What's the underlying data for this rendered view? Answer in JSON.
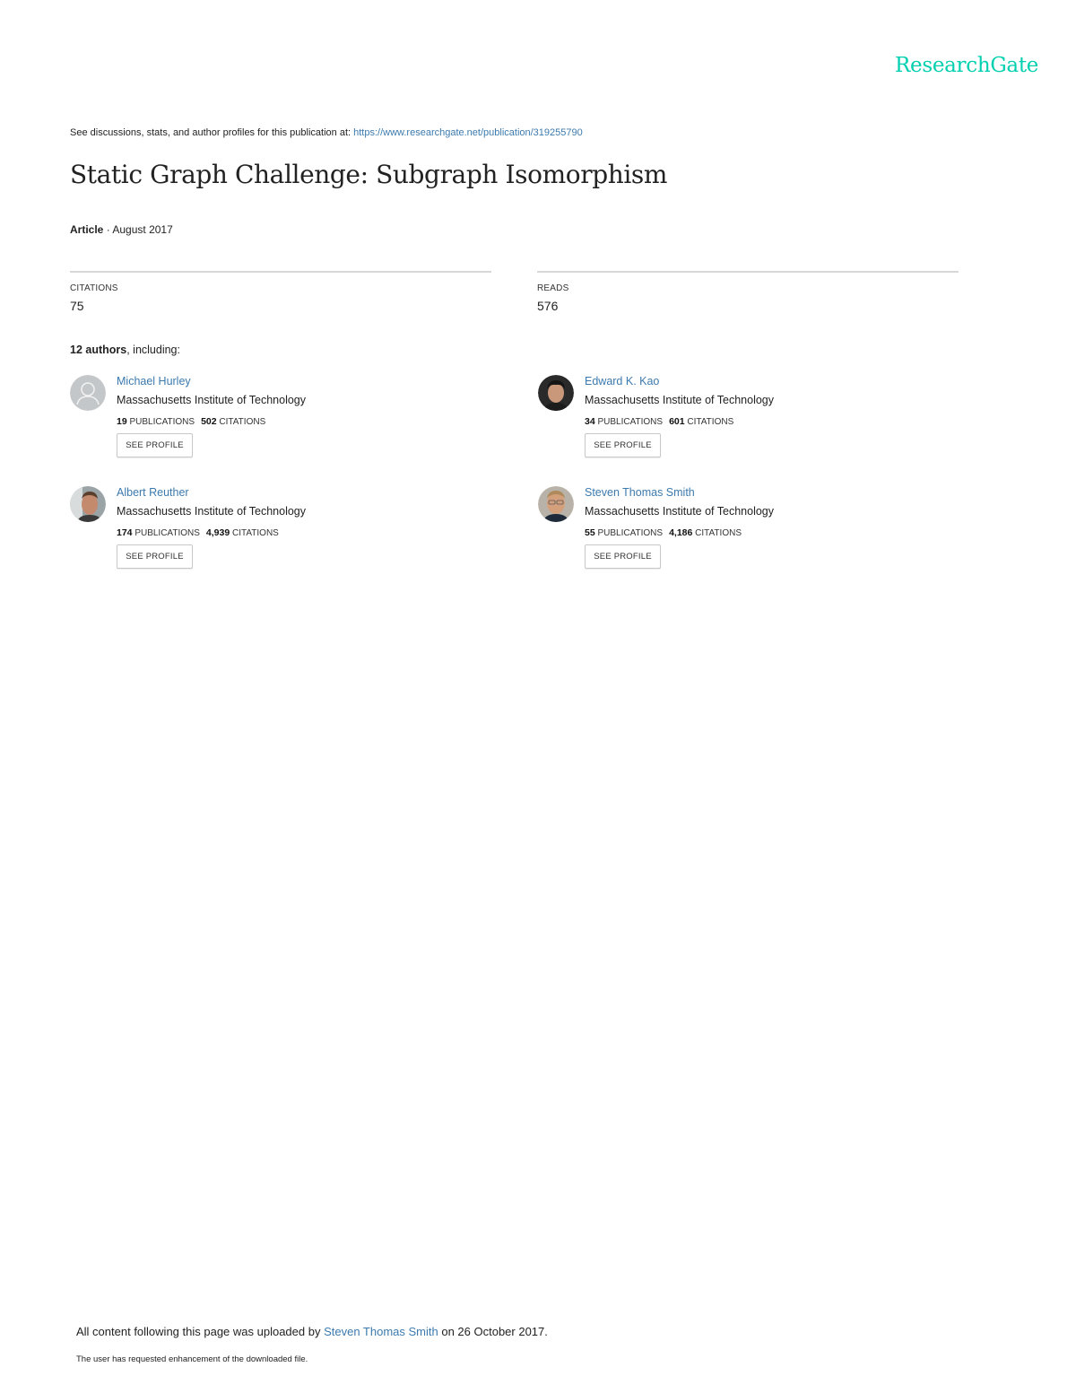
{
  "brand": {
    "name": "ResearchGate",
    "color": "#00d0af"
  },
  "header": {
    "intro_text": "See discussions, stats, and author profiles for this publication at: ",
    "publication_url": "https://www.researchgate.net/publication/319255790"
  },
  "publication": {
    "title": "Static Graph Challenge: Subgraph Isomorphism",
    "type": "Article",
    "separator": " · ",
    "date": "August 2017"
  },
  "stats": {
    "citations_label": "CITATIONS",
    "citations_value": "75",
    "reads_label": "READS",
    "reads_value": "576"
  },
  "authors_heading": {
    "count": "12 authors",
    "suffix": ", including:"
  },
  "authors": [
    {
      "name": "Michael Hurley",
      "institution": "Massachusetts Institute of Technology",
      "publications": "19",
      "publications_label": "PUBLICATIONS",
      "citations": "502",
      "citations_label": "CITATIONS",
      "button": "SEE PROFILE",
      "avatar": "placeholder-avatar"
    },
    {
      "name": "Edward K. Kao",
      "institution": "Massachusetts Institute of Technology",
      "publications": "34",
      "publications_label": "PUBLICATIONS",
      "citations": "601",
      "citations_label": "CITATIONS",
      "button": "SEE PROFILE",
      "avatar": "photo-avatar"
    },
    {
      "name": "Albert Reuther",
      "institution": "Massachusetts Institute of Technology",
      "publications": "174",
      "publications_label": "PUBLICATIONS",
      "citations": "4,939",
      "citations_label": "CITATIONS",
      "button": "SEE PROFILE",
      "avatar": "photo-avatar"
    },
    {
      "name": "Steven Thomas Smith",
      "institution": "Massachusetts Institute of Technology",
      "publications": "55",
      "publications_label": "PUBLICATIONS",
      "citations": "4,186",
      "citations_label": "CITATIONS",
      "button": "SEE PROFILE",
      "avatar": "photo-avatar"
    }
  ],
  "footer": {
    "upload_prefix": "All content following this page was uploaded by ",
    "uploader": "Steven Thomas Smith",
    "upload_suffix": " on 26 October 2017.",
    "enhancement_note": "The user has requested enhancement of the downloaded file."
  }
}
